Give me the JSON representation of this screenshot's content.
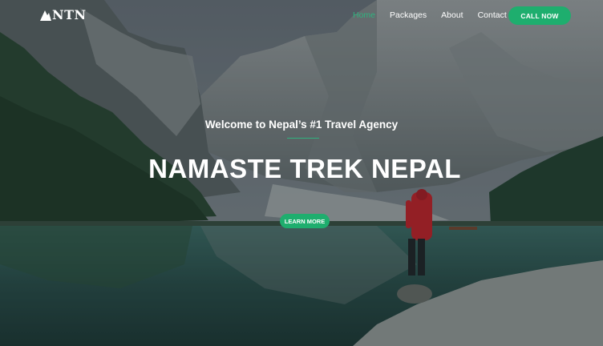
{
  "brand": {
    "logo_text": "NTN",
    "logo_icon": "mountain-icon"
  },
  "nav": {
    "items": [
      {
        "label": "Home",
        "active": true
      },
      {
        "label": "Packages",
        "active": false
      },
      {
        "label": "About",
        "active": false
      },
      {
        "label": "Contact",
        "active": false
      }
    ],
    "cta_label": "CALL NOW"
  },
  "hero": {
    "subtitle": "Welcome to Nepal’s #1 Travel Agency",
    "title": "NAMASTE TREK NEPAL",
    "button_label": "LEARN MORE"
  },
  "colors": {
    "accent": "#1eae6e",
    "active_link": "#2fb37f"
  }
}
